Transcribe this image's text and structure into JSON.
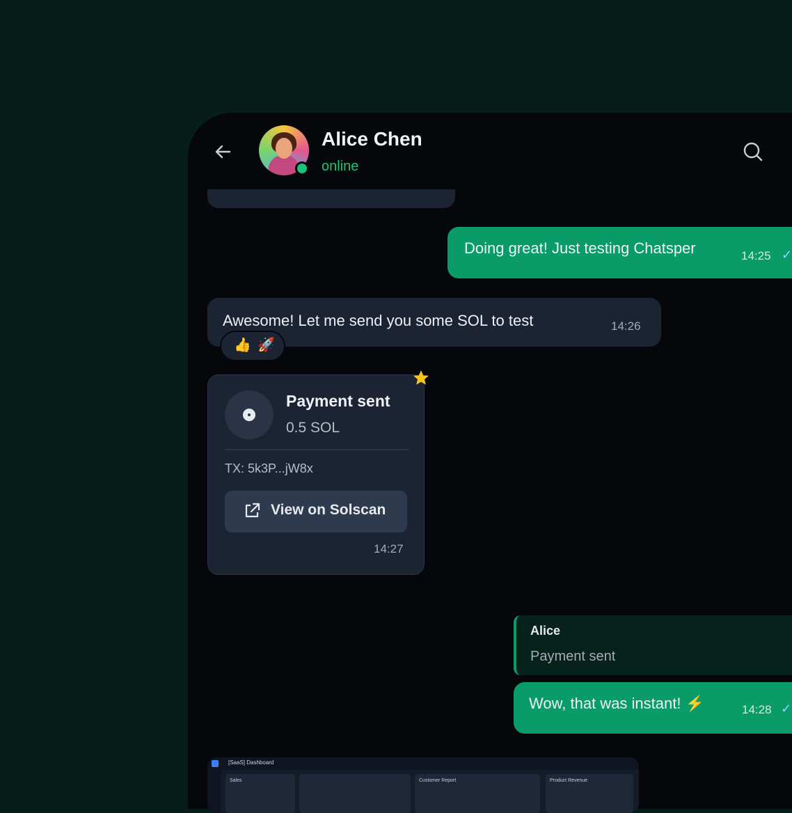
{
  "header": {
    "contact_name": "Alice Chen",
    "status": "online",
    "back_icon": "arrow-left-icon",
    "search_icon": "search-icon"
  },
  "messages": [
    {
      "id": "m1",
      "direction": "outgoing",
      "text": "Doing great! Just testing Chatsper",
      "time": "14:25",
      "status": "read"
    },
    {
      "id": "m2",
      "direction": "incoming",
      "text": "Awesome! Let me send you some SOL to test",
      "time": "14:26",
      "reactions": [
        "👍",
        "🚀"
      ]
    },
    {
      "id": "m3",
      "direction": "incoming",
      "type": "payment",
      "starred": true,
      "title": "Payment sent",
      "amount": "0.5 SOL",
      "tx": "TX: 5k3P...jW8x",
      "button_label": "View on Solscan",
      "time": "14:27"
    },
    {
      "id": "m4",
      "direction": "outgoing",
      "reply_to": {
        "author": "Alice",
        "text": "Payment sent"
      },
      "text": "Wow, that was instant! ⚡",
      "time": "14:28",
      "status": "read"
    }
  ],
  "attachment_preview": {
    "title": "[SaaS] Dashboard",
    "panels": [
      "Sales",
      "Customer Report",
      "Product Revenue"
    ]
  },
  "colors": {
    "background": "#071d17",
    "chat_bg": "#05070b",
    "incoming_bubble": "#1c2434",
    "outgoing_bubble": "#0a9c68",
    "accent_online": "#19c37d",
    "star": "#f5c518"
  }
}
